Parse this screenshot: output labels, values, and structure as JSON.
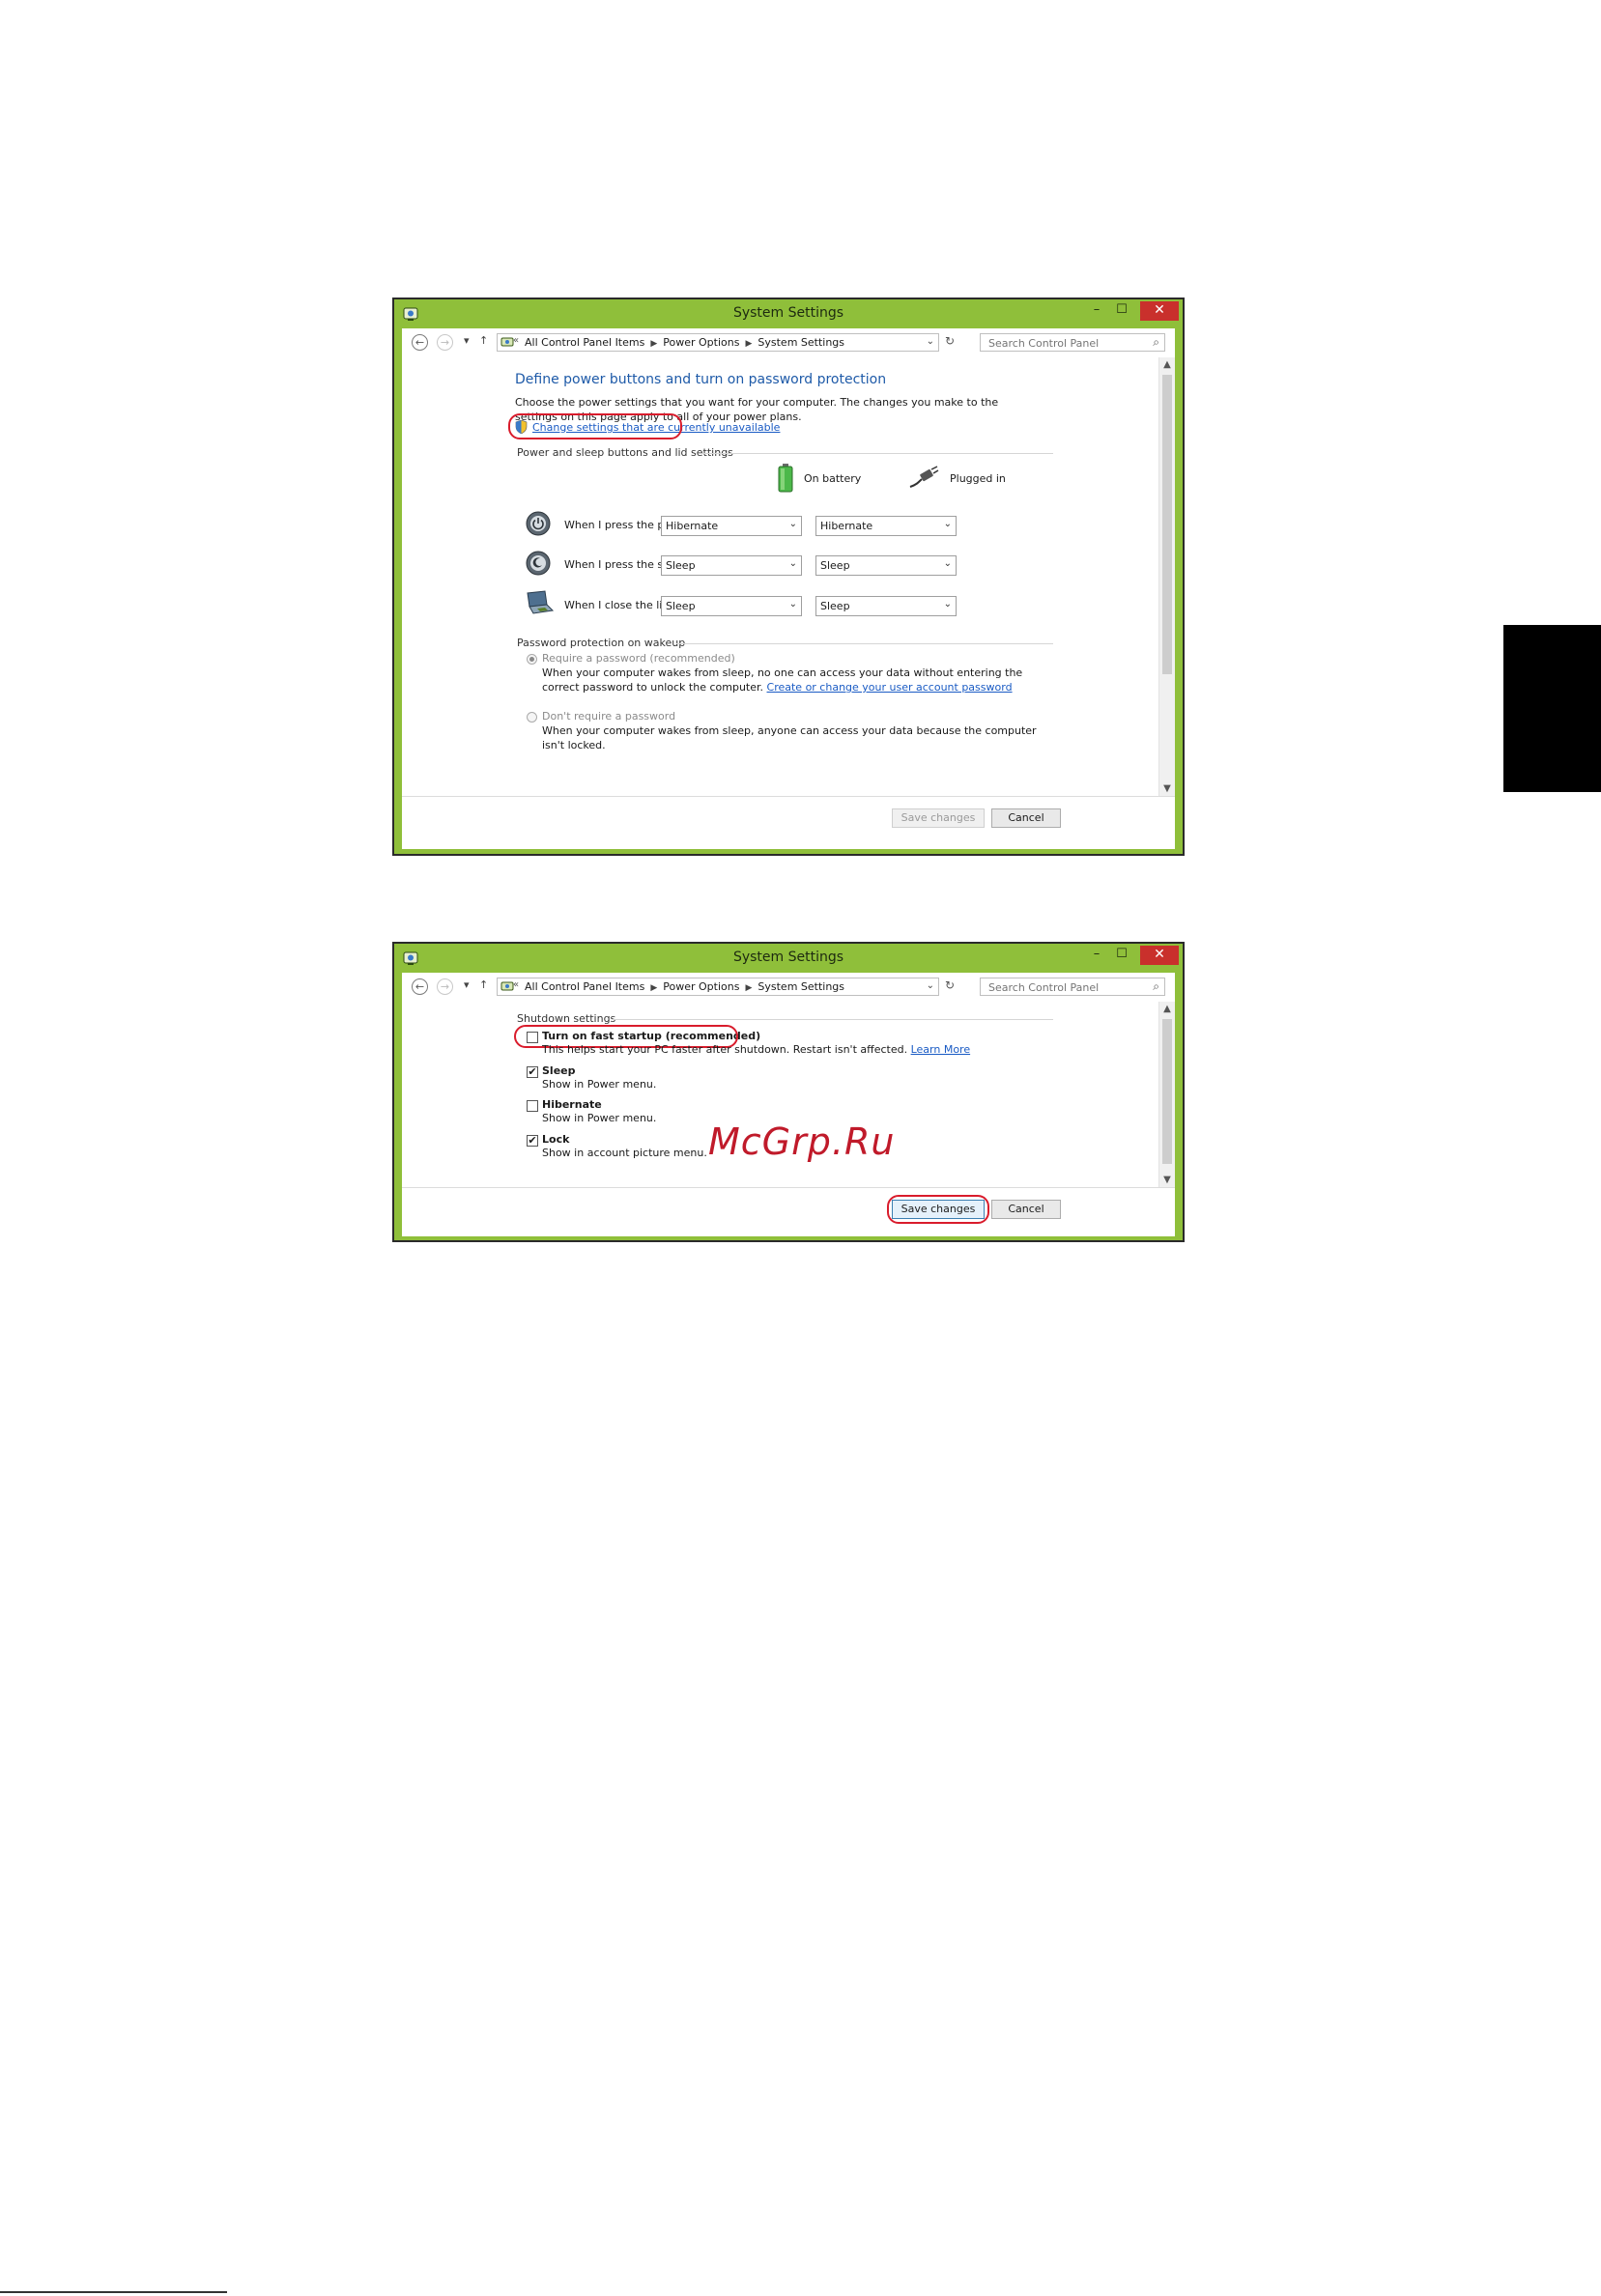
{
  "window_title": "System Settings",
  "controls": {
    "minimize": "–",
    "maximize": "☐",
    "close": "✕"
  },
  "nav": {
    "back": "←",
    "forward": "→",
    "recent": "▾",
    "up": "↑",
    "crumb_prefix": "«",
    "crumbs": [
      "All Control Panel Items",
      "Power Options",
      "System Settings"
    ],
    "search_placeholder": "Search Control Panel"
  },
  "screen1": {
    "heading": "Define power buttons and turn on password protection",
    "description": "Choose the power settings that you want for your computer. The changes you make to the settings on this page apply to all of your power plans.",
    "change_link": "Change settings that are currently unavailable",
    "section_buttons": "Power and sleep buttons and lid settings",
    "col_battery": "On battery",
    "col_plugged": "Plugged in",
    "rows": [
      {
        "label": "When I press the power button:",
        "battery": "Hibernate",
        "plugged": "Hibernate"
      },
      {
        "label": "When I press the sleep button:",
        "battery": "Sleep",
        "plugged": "Sleep"
      },
      {
        "label": "When I close the lid:",
        "battery": "Sleep",
        "plugged": "Sleep"
      }
    ],
    "section_password": "Password protection on wakeup",
    "require_label": "Require a password (recommended)",
    "require_desc": "When your computer wakes from sleep, no one can access your data without entering the correct password to unlock the computer.",
    "require_link": "Create or change your user account password",
    "norequire_label": "Don't require a password",
    "norequire_desc": "When your computer wakes from sleep, anyone can access your data because the computer isn't locked.",
    "save": "Save changes",
    "cancel": "Cancel"
  },
  "screen2": {
    "section": "Shutdown settings",
    "fast_label": "Turn on fast startup (recommended)",
    "fast_desc": "This helps start your PC faster after shutdown. Restart isn't affected.",
    "fast_link": "Learn More",
    "sleep_label": "Sleep",
    "sleep_desc": "Show in Power menu.",
    "hibernate_label": "Hibernate",
    "hibernate_desc": "Show in Power menu.",
    "lock_label": "Lock",
    "lock_desc": "Show in account picture menu.",
    "save": "Save changes",
    "cancel": "Cancel"
  },
  "checked": {
    "fast_startup": false,
    "sleep": true,
    "hibernate": false,
    "lock": true
  },
  "watermark": "McGrp.Ru",
  "colors": {
    "frame": "#8fbf3a",
    "accent_link": "#1a5bc4",
    "heading": "#1e5aa8",
    "highlight": "#d91c2c",
    "close": "#c9302c"
  }
}
